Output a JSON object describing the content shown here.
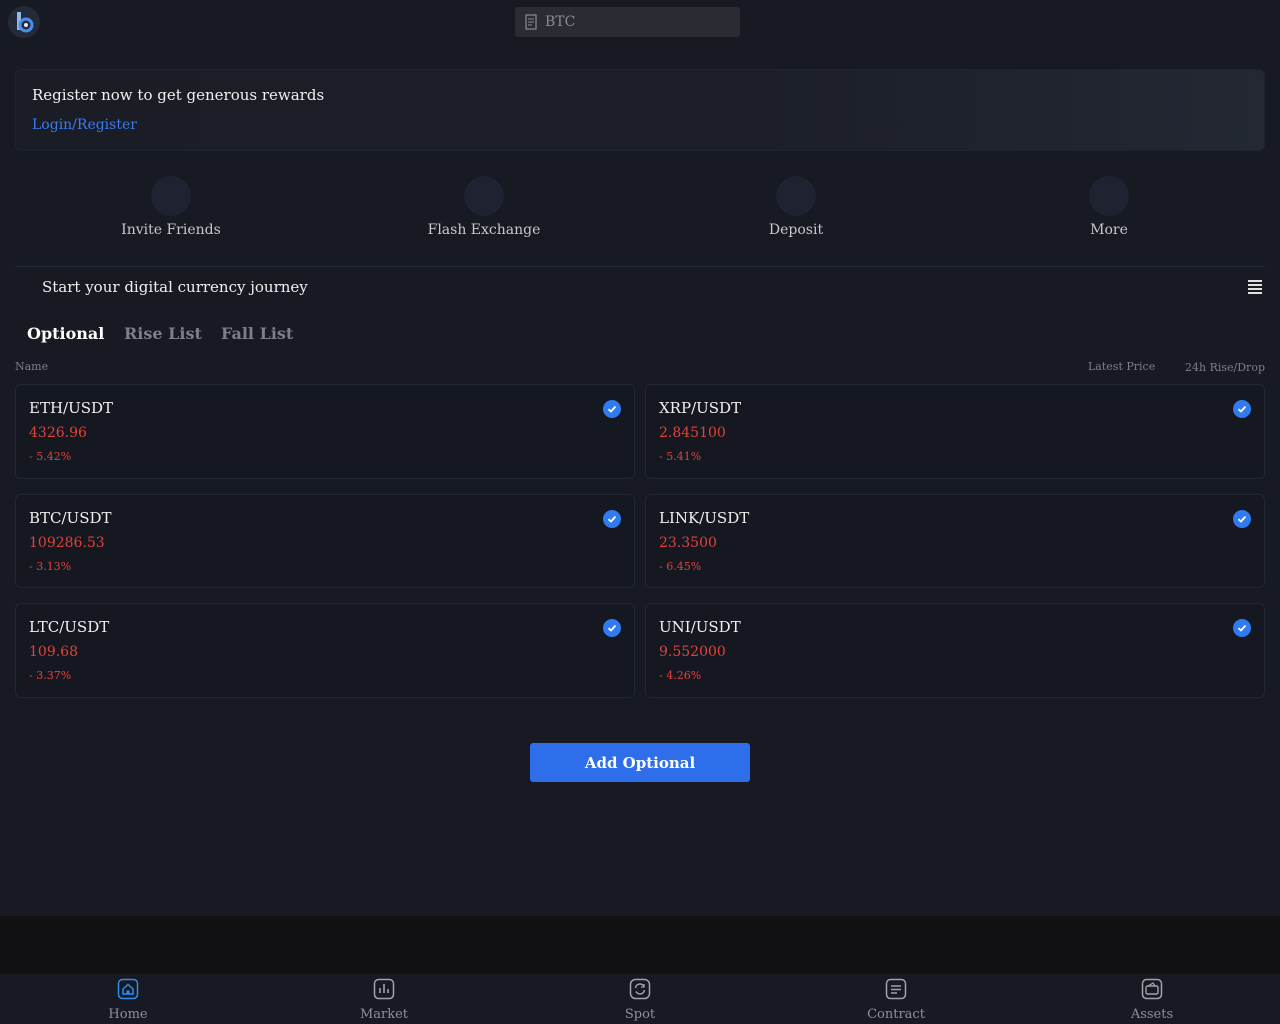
{
  "header": {
    "logo_letter": "b",
    "search_placeholder": "BTC"
  },
  "banner": {
    "title": "Register now to get generous rewards",
    "link": "Login/Register"
  },
  "quick_actions": [
    {
      "label": "Invite Friends"
    },
    {
      "label": "Flash Exchange"
    },
    {
      "label": "Deposit"
    },
    {
      "label": "More"
    }
  ],
  "journey_text": "Start your digital currency journey",
  "tabs": [
    {
      "label": "Optional",
      "active": true
    },
    {
      "label": "Rise List",
      "active": false
    },
    {
      "label": "Fall List",
      "active": false
    }
  ],
  "columns": {
    "name": "Name",
    "latest_price": "Latest Price",
    "change": "24h Rise/Drop"
  },
  "markets": [
    {
      "pair": "ETH/USDT",
      "price": "4326.96",
      "change": "- 5.42%",
      "checked": true
    },
    {
      "pair": "XRP/USDT",
      "price": "2.845100",
      "change": "- 5.41%",
      "checked": true
    },
    {
      "pair": "BTC/USDT",
      "price": "109286.53",
      "change": "- 3.13%",
      "checked": true
    },
    {
      "pair": "LINK/USDT",
      "price": "23.3500",
      "change": "- 6.45%",
      "checked": true
    },
    {
      "pair": "LTC/USDT",
      "price": "109.68",
      "change": "- 3.37%",
      "checked": true
    },
    {
      "pair": "UNI/USDT",
      "price": "9.552000",
      "change": "- 4.26%",
      "checked": true
    }
  ],
  "add_button": "Add Optional",
  "bottom_nav": [
    {
      "label": "Home",
      "icon": "home-icon",
      "active": true
    },
    {
      "label": "Market",
      "icon": "chart-icon",
      "active": false
    },
    {
      "label": "Spot",
      "icon": "exchange-icon",
      "active": false
    },
    {
      "label": "Contract",
      "icon": "document-icon",
      "active": false
    },
    {
      "label": "Assets",
      "icon": "wallet-icon",
      "active": false
    }
  ],
  "colors": {
    "accent": "#2f6eea",
    "down": "#e0423a",
    "background": "#171923",
    "link": "#3a7bf2"
  }
}
